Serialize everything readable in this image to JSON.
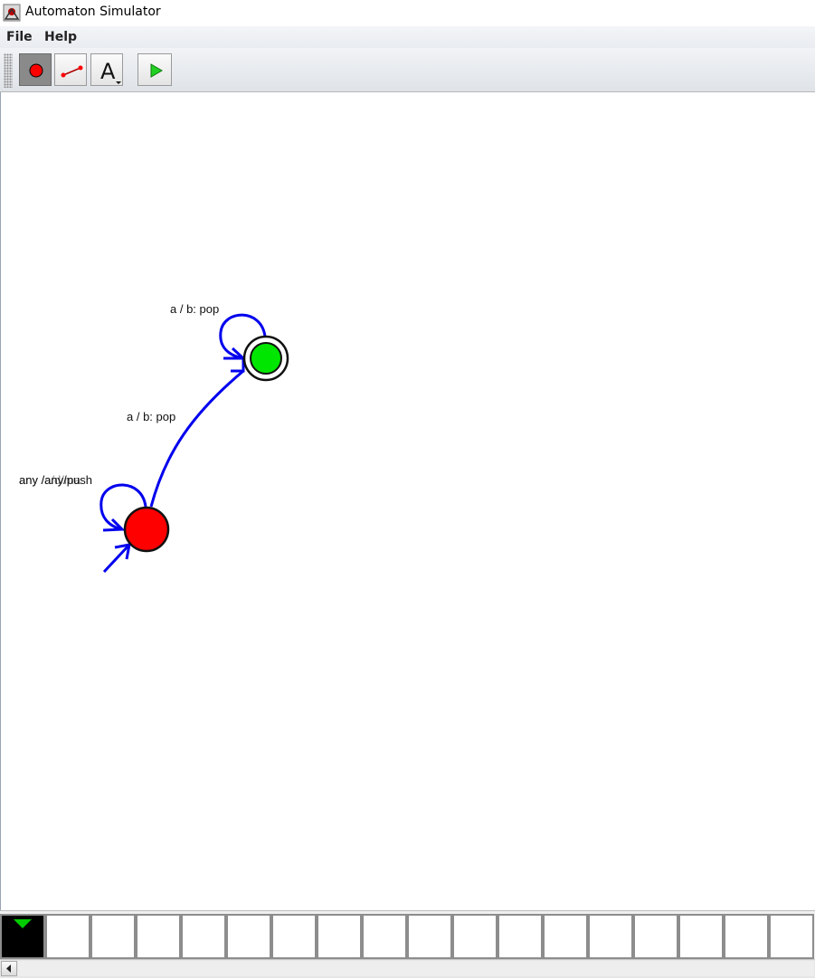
{
  "window": {
    "title": "Automaton Simulator"
  },
  "menu": {
    "items": [
      {
        "label": "File"
      },
      {
        "label": "Help"
      }
    ]
  },
  "toolbar": {
    "tools": [
      {
        "name": "state-tool",
        "icon": "red-circle-icon",
        "selected": true
      },
      {
        "name": "transition-tool",
        "icon": "line-connector-icon",
        "selected": false
      },
      {
        "name": "text-tool",
        "icon": "letter-a-dropdown-icon",
        "selected": false
      },
      {
        "name": "run-tool",
        "icon": "green-play-icon",
        "selected": false
      }
    ],
    "text_tool_glyph": "A"
  },
  "automaton": {
    "states": [
      {
        "id": "q0",
        "start": true,
        "accepting": false,
        "color": "#ff0000"
      },
      {
        "id": "q1",
        "start": false,
        "accepting": true,
        "color": "#00e600"
      }
    ],
    "transitions": [
      {
        "from": "q0",
        "to": "q0",
        "label": "any /any/push"
      },
      {
        "from": "q0",
        "to": "q1",
        "label": "a / b: pop"
      },
      {
        "from": "q1",
        "to": "q1",
        "label": "a / b: pop"
      }
    ],
    "edge_color": "#0000ee",
    "overlap_label": "any /any/push",
    "overlap_label_ghost": "any /a/d/ma"
  },
  "tape": {
    "cell_count": 18,
    "head_index": 0,
    "head_color": "#00cc00"
  }
}
